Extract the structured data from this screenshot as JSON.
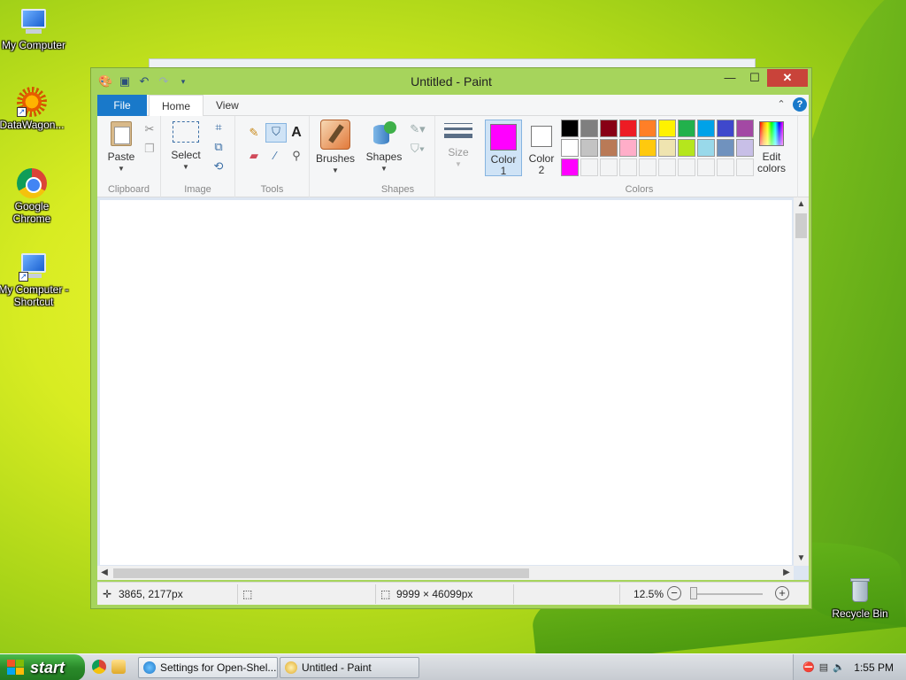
{
  "desktop": {
    "icons": [
      {
        "label": "My Computer"
      },
      {
        "label": "DataWagon..."
      },
      {
        "label": "Google Chrome"
      },
      {
        "label": "My Computer - Shortcut"
      },
      {
        "label": "Recycle Bin"
      }
    ]
  },
  "window": {
    "title": "Untitled - Paint",
    "controls": {
      "minimize": "—",
      "maximize": "☐",
      "close": "✕"
    }
  },
  "tabs": {
    "file": "File",
    "home": "Home",
    "view": "View"
  },
  "ribbon": {
    "clipboard": {
      "paste": "Paste",
      "group": "Clipboard"
    },
    "image": {
      "select": "Select",
      "group": "Image"
    },
    "tools": {
      "group": "Tools"
    },
    "brushes": {
      "label": "Brushes"
    },
    "shapes": {
      "label": "Shapes",
      "group": "Shapes"
    },
    "size": {
      "label": "Size"
    },
    "colors": {
      "color1_line1": "Color",
      "color1_line2": "1",
      "color2_line1": "Color",
      "color2_line2": "2",
      "edit_line1": "Edit",
      "edit_line2": "colors",
      "group": "Colors",
      "color1_value": "#ff00ff",
      "color2_value": "#ffffff",
      "palette_row1": [
        "#000000",
        "#7f7f7f",
        "#880015",
        "#ed1c24",
        "#ff7f27",
        "#fff200",
        "#22b14c",
        "#00a2e8",
        "#3f48cc",
        "#a349a4"
      ],
      "palette_row2": [
        "#ffffff",
        "#c3c3c3",
        "#b97a57",
        "#ffaec9",
        "#ffc90e",
        "#efe4b0",
        "#b5e61d",
        "#99d9ea",
        "#7092be",
        "#c8bfe7"
      ],
      "palette_row3": [
        "#ff00ff"
      ]
    }
  },
  "status": {
    "cursor_pos": "3865, 2177px",
    "canvas_size": "9999 × 46099px",
    "zoom": "12.5%"
  },
  "taskbar": {
    "start": "start",
    "tasks": [
      {
        "label": "Settings for Open-Shel..."
      },
      {
        "label": "Untitled - Paint"
      }
    ],
    "clock": "1:55 PM"
  }
}
